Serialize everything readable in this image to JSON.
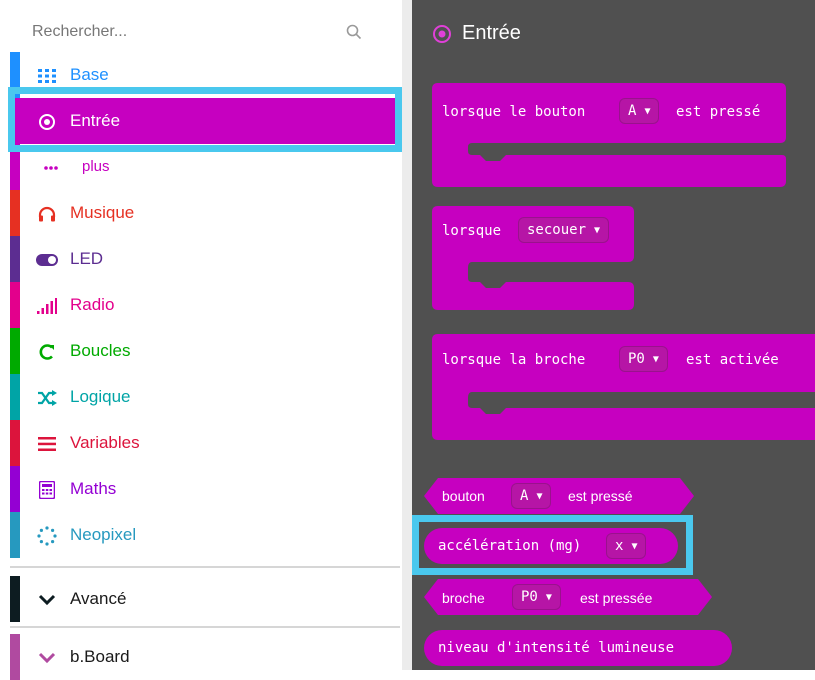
{
  "search": {
    "placeholder": "Rechercher...",
    "icon": "search-icon"
  },
  "categories": [
    {
      "label": "Base",
      "color": "#1e90ff",
      "icon": "grid-icon"
    },
    {
      "label": "Entrée",
      "color": "#c600c0",
      "icon": "target-icon"
    },
    {
      "label": "plus",
      "color": "#c600c0",
      "icon": "more-dots-icon"
    },
    {
      "label": "Musique",
      "color": "#e63022",
      "icon": "headphones-icon"
    },
    {
      "label": "LED",
      "color": "#5c2d91",
      "icon": "toggle-icon"
    },
    {
      "label": "Radio",
      "color": "#e3008c",
      "icon": "signal-bars-icon"
    },
    {
      "label": "Boucles",
      "color": "#00aa00",
      "icon": "loop-arrow-icon"
    },
    {
      "label": "Logique",
      "color": "#00a4a6",
      "icon": "shuffle-icon"
    },
    {
      "label": "Variables",
      "color": "#dc143c",
      "icon": "lines-icon"
    },
    {
      "label": "Maths",
      "color": "#9400d3",
      "icon": "calculator-icon"
    },
    {
      "label": "Neopixel",
      "color": "#2699bf",
      "icon": "dotted-circle-icon"
    },
    {
      "label": "Avancé",
      "color": "#0d1c21",
      "icon": "chevron-down-icon"
    },
    {
      "label": "b.Board",
      "color": "#b04aa0",
      "icon": "chevron-down-icon"
    }
  ],
  "flyout": {
    "title": "Entrée",
    "title_icon": "target-icon",
    "block_color": "#c600c0",
    "blocks": {
      "button_pressed": {
        "text1": "lorsque le bouton",
        "dropdown": "A",
        "text2": "est pressé"
      },
      "gesture": {
        "text1": "lorsque",
        "dropdown": "secouer"
      },
      "pin_pressed": {
        "text1": "lorsque la broche",
        "dropdown": "P0",
        "text2": "est activée"
      },
      "is_pressed": {
        "text1": "bouton",
        "dropdown": "A",
        "text2": "est pressé"
      },
      "acceleration": {
        "text1": "accélération (mg)",
        "dropdown": "x"
      },
      "pin_is_pressed": {
        "text1": "broche",
        "dropdown": "P0",
        "text2": "est pressée"
      },
      "light_level": {
        "text1": "niveau d'intensité lumineuse"
      }
    }
  },
  "highlight_color": "#4ac8ee"
}
